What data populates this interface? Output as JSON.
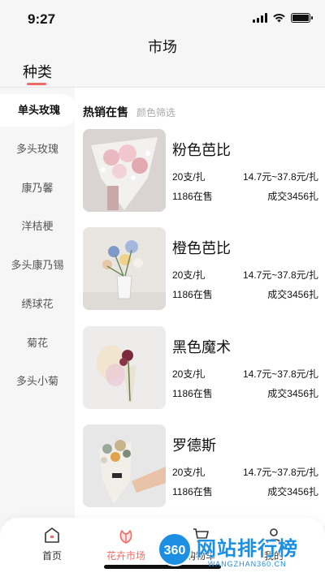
{
  "status_bar": {
    "time": "9:27"
  },
  "header": {
    "title": "市场",
    "category_tab": "种类"
  },
  "sidebar": {
    "items": [
      {
        "label": "单头玫瑰",
        "active": true
      },
      {
        "label": "多头玫瑰",
        "active": false
      },
      {
        "label": "康乃馨",
        "active": false
      },
      {
        "label": "洋桔梗",
        "active": false
      },
      {
        "label": "多头康乃锡",
        "active": false
      },
      {
        "label": "绣球花",
        "active": false
      },
      {
        "label": "菊花",
        "active": false
      },
      {
        "label": "多头小菊",
        "active": false
      }
    ]
  },
  "main": {
    "section_title": "热销在售",
    "section_subtitle": "颜色筛选",
    "products": [
      {
        "name": "粉色芭比",
        "spec": "20支/扎",
        "price": "14.7元~37.8元/扎",
        "stock": "1186在售",
        "deals": "成交3456扎",
        "image_icon": "pink-bouquet-photo"
      },
      {
        "name": "橙色芭比",
        "spec": "20支/扎",
        "price": "14.7元~37.8元/扎",
        "stock": "1186在售",
        "deals": "成交3456扎",
        "image_icon": "vase-flowers-photo"
      },
      {
        "name": "黑色魔术",
        "spec": "20支/扎",
        "price": "14.7元~37.8元/扎",
        "stock": "1186在售",
        "deals": "成交3456扎",
        "image_icon": "single-flower-photo"
      },
      {
        "name": "罗德斯",
        "spec": "20支/扎",
        "price": "14.7元~37.8元/扎",
        "stock": "1186在售",
        "deals": "成交3456扎",
        "image_icon": "hand-bouquet-photo"
      }
    ]
  },
  "bottom_nav": {
    "items": [
      {
        "label": "首页",
        "icon": "home-icon",
        "active": false
      },
      {
        "label": "花卉市场",
        "icon": "flower-icon",
        "active": true
      },
      {
        "label": "购物车",
        "icon": "cart-icon",
        "active": false
      },
      {
        "label": "我的",
        "icon": "user-icon",
        "active": false
      }
    ]
  },
  "watermark": {
    "badge": "360",
    "text": "网站排行榜",
    "url": "WANGZHAN360.CN"
  },
  "colors": {
    "accent": "#ef6b66",
    "watermark": "#1c8fe3"
  }
}
